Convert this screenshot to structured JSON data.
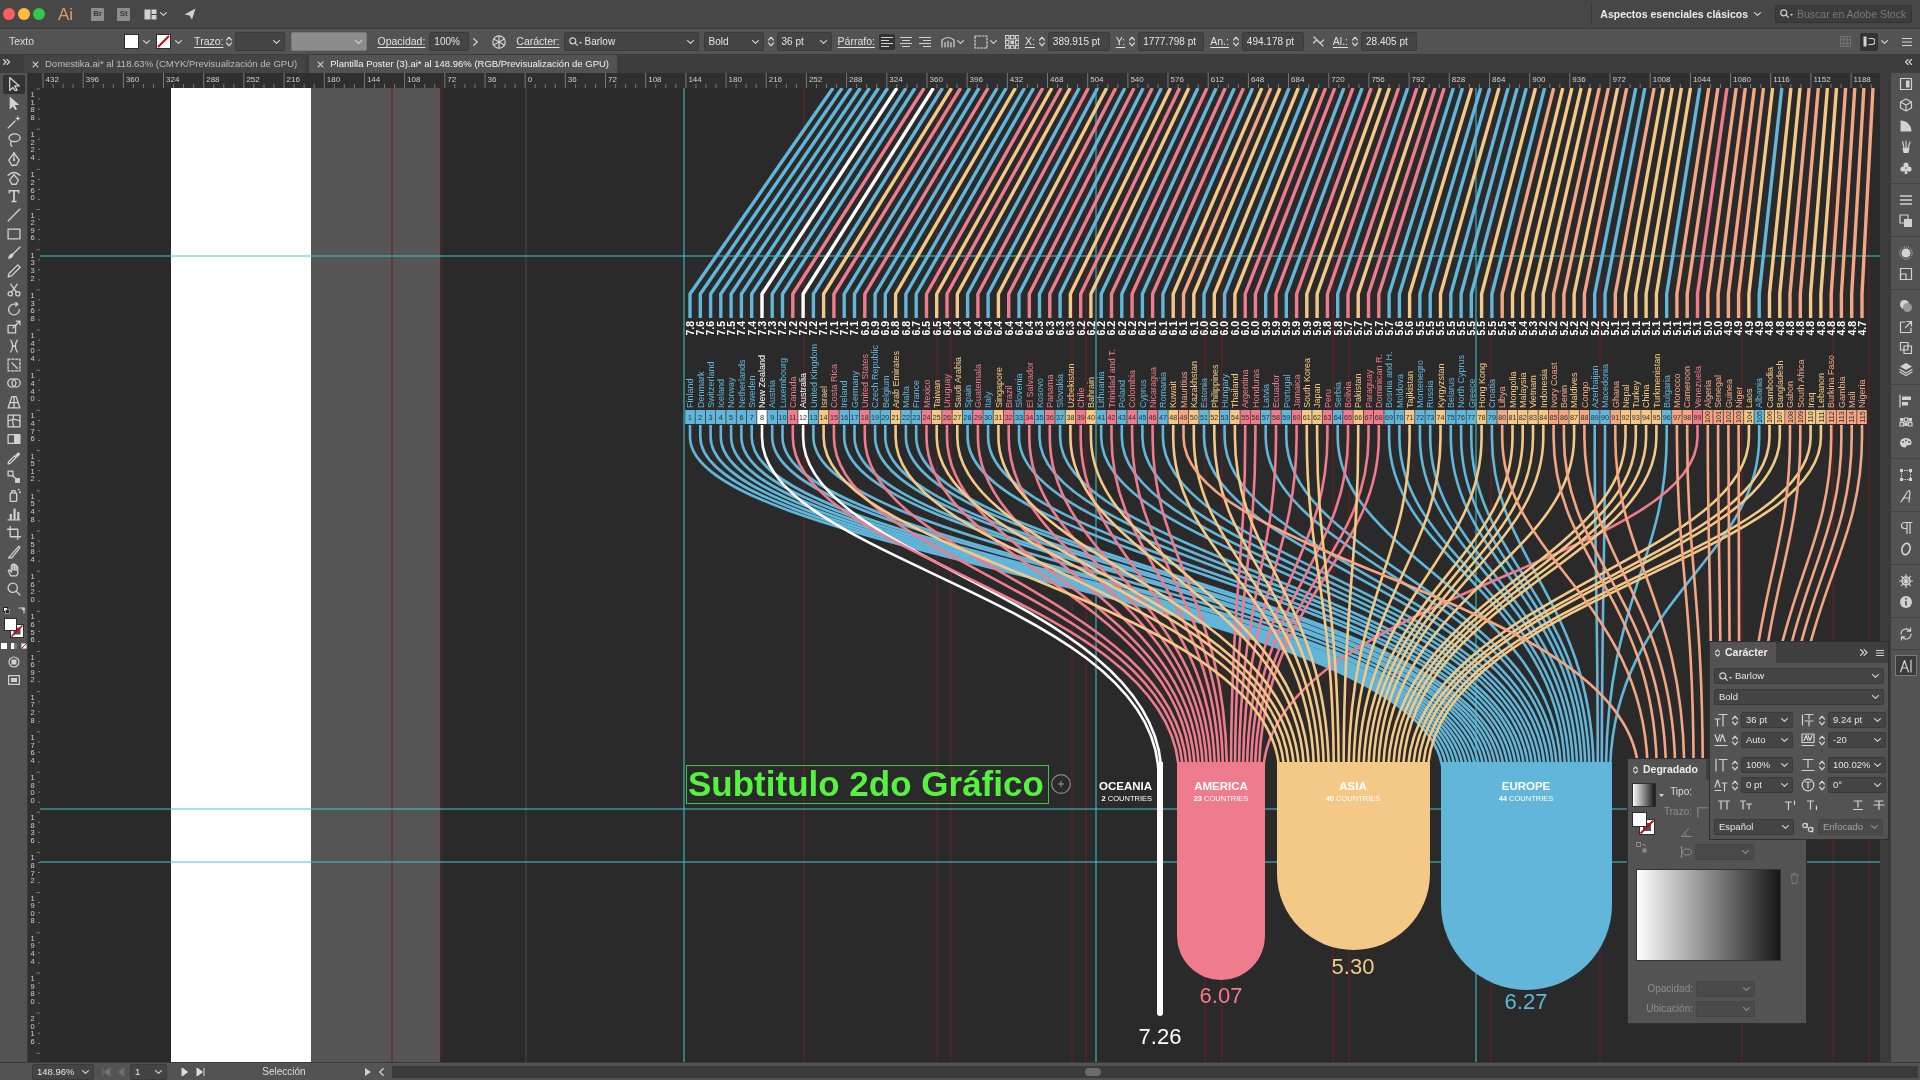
{
  "menubar": {
    "app_logo": "Ai",
    "apps": [
      "Br",
      "St"
    ],
    "workspace": "Aspectos esenciales clásicos",
    "search": {
      "placeholder": "Buscar en Adobe Stock"
    }
  },
  "control_bar": {
    "tool": "Texto",
    "stroke_label": "Trazo:",
    "opacity_label": "Opacidad:",
    "opacity": "100%",
    "character_label": "Carácter:",
    "font": "Barlow",
    "style": "Bold",
    "size": "36 pt",
    "paragraph_label": "Párrafo:",
    "align_buttons": [
      {
        "selected": true
      },
      {
        "selected": false
      },
      {
        "selected": false
      }
    ],
    "fields": [
      {
        "label": "X:",
        "value": "389.915 pt"
      },
      {
        "label": "Y:",
        "value": "1777.798 pt"
      },
      {
        "label": "An.:",
        "value": "494.178 pt"
      },
      {
        "label": "Al.:",
        "value": "28.405 pt"
      }
    ],
    "snap_toggle": {
      "on": true
    }
  },
  "tabs": [
    {
      "label": "Domestika.ai* al 118.63% (CMYK/Previsualización de GPU)",
      "selected": false
    },
    {
      "label": "Plantilla Poster (3).ai* al 148.96% (RGB/Previsualización de GPU)",
      "selected": true
    }
  ],
  "ruler": {
    "labels": [
      "432",
      "396",
      "360",
      "324",
      "288",
      "252",
      "216",
      "180",
      "144",
      "108",
      "72",
      "36",
      "0",
      "36",
      "72",
      "108",
      "144",
      "180",
      "216",
      "252",
      "288",
      "324",
      "360",
      "396",
      "432",
      "468",
      "504",
      "540",
      "576",
      "612",
      "648",
      "684",
      "720",
      "756",
      "792",
      "828",
      "864",
      "900",
      "936",
      "972",
      "1008",
      "1044",
      "1080",
      "1116",
      "1152",
      "1188"
    ]
  },
  "vertical_ruler": {
    "labels": [
      "1188",
      "1224",
      "1260",
      "1296",
      "1332",
      "1368",
      "1404",
      "1440",
      "1476",
      "1512",
      "1548",
      "1584",
      "1620",
      "1656",
      "1692",
      "1728",
      "1764",
      "1800",
      "1836",
      "1872",
      "1908",
      "1944",
      "1980",
      "2016"
    ]
  },
  "tools": [
    {
      "selected": true
    },
    {
      "selected": false
    },
    {
      "selected": false
    },
    {
      "selected": false
    },
    {
      "selected": false
    },
    {
      "selected": false
    },
    {
      "selected": false
    },
    {
      "selected": false
    },
    {
      "selected": false
    },
    {
      "selected": false
    },
    {
      "selected": false
    },
    {
      "selected": false
    },
    {
      "selected": false
    },
    {
      "selected": false
    },
    {
      "selected": false
    },
    {
      "selected": false
    },
    {
      "selected": false
    },
    {
      "selected": false
    },
    {
      "selected": false
    },
    {
      "selected": false
    },
    {
      "selected": false
    },
    {
      "selected": false
    },
    {
      "selected": false
    },
    {
      "selected": false
    },
    {
      "selected": false
    },
    {
      "selected": false
    },
    {
      "selected": false
    },
    {
      "selected": false
    }
  ],
  "dock": [
    {
      "selected": false
    },
    {
      "selected": false
    },
    {
      "selected": false
    },
    {
      "selected": false
    },
    {
      "selected": false
    },
    {
      "selected": false
    },
    {
      "selected": false
    },
    {
      "selected": false
    },
    {
      "selected": false
    },
    {
      "selected": false
    },
    {
      "selected": false
    },
    {
      "selected": false
    },
    {
      "selected": false
    },
    {
      "selected": false
    },
    {
      "selected": false
    },
    {
      "selected": false
    },
    {
      "selected": false
    },
    {
      "selected": false
    },
    {
      "selected": false
    },
    {
      "selected": false
    },
    {
      "selected": false
    },
    {
      "selected": false
    },
    {
      "selected": false
    },
    {
      "selected": true
    }
  ],
  "canvas": {
    "subtitle": "Subtitulo 2do Gráfico",
    "countries": [
      {
        "rank": "1",
        "name": "Finland",
        "score": "7.8",
        "color": "#62b6da"
      },
      {
        "rank": "2",
        "name": "Denmark",
        "score": "7.6",
        "color": "#62b6da"
      },
      {
        "rank": "3",
        "name": "Switzerland",
        "score": "7.6",
        "color": "#62b6da"
      },
      {
        "rank": "4",
        "name": "Iceland",
        "score": "7.5",
        "color": "#62b6da"
      },
      {
        "rank": "5",
        "name": "Norway",
        "score": "7.5",
        "color": "#62b6da"
      },
      {
        "rank": "6",
        "name": "Netherlands",
        "score": "7.4",
        "color": "#62b6da"
      },
      {
        "rank": "7",
        "name": "Sweden",
        "score": "7.4",
        "color": "#62b6da"
      },
      {
        "rank": "8",
        "name": "New Zealand",
        "score": "7.3",
        "color": "#ffffff"
      },
      {
        "rank": "9",
        "name": "Austria",
        "score": "7.3",
        "color": "#62b6da"
      },
      {
        "rank": "10",
        "name": "Luxembourg",
        "score": "7.2",
        "color": "#62b6da"
      },
      {
        "rank": "11",
        "name": "Canada",
        "score": "7.2",
        "color": "#ee7c8d"
      },
      {
        "rank": "12",
        "name": "Australia",
        "score": "7.2",
        "color": "#ffffff"
      },
      {
        "rank": "13",
        "name": "United Kingdom",
        "score": "7.2",
        "color": "#62b6da"
      },
      {
        "rank": "14",
        "name": "Israel",
        "score": "7.1",
        "color": "#f4c987"
      },
      {
        "rank": "15",
        "name": "Costa Rica",
        "score": "7.1",
        "color": "#ee7c8d"
      },
      {
        "rank": "16",
        "name": "Ireland",
        "score": "7.1",
        "color": "#62b6da"
      },
      {
        "rank": "17",
        "name": "Germany",
        "score": "7.1",
        "color": "#62b6da"
      },
      {
        "rank": "18",
        "name": "United States",
        "score": "6.9",
        "color": "#ee7c8d"
      },
      {
        "rank": "19",
        "name": "Czech Republic",
        "score": "6.9",
        "color": "#62b6da"
      },
      {
        "rank": "20",
        "name": "Belgium",
        "score": "6.9",
        "color": "#62b6da"
      },
      {
        "rank": "21",
        "name": "Arab Emirates",
        "score": "6.8",
        "color": "#f4c987"
      },
      {
        "rank": "22",
        "name": "Malta",
        "score": "6.8",
        "color": "#62b6da"
      },
      {
        "rank": "23",
        "name": "France",
        "score": "6.7",
        "color": "#62b6da"
      },
      {
        "rank": "24",
        "name": "Mexico",
        "score": "6.5",
        "color": "#ee7c8d"
      },
      {
        "rank": "25",
        "name": "Taiwan",
        "score": "6.5",
        "color": "#f4c987"
      },
      {
        "rank": "26",
        "name": "Uruguay",
        "score": "6.4",
        "color": "#ee7c8d"
      },
      {
        "rank": "27",
        "name": "Saudi Arabia",
        "score": "6.4",
        "color": "#f4c987"
      },
      {
        "rank": "28",
        "name": "Spain",
        "score": "6.4",
        "color": "#62b6da"
      },
      {
        "rank": "29",
        "name": "Guatemala",
        "score": "6.4",
        "color": "#ee7c8d"
      },
      {
        "rank": "30",
        "name": "Italy",
        "score": "6.4",
        "color": "#62b6da"
      },
      {
        "rank": "31",
        "name": "Singapore",
        "score": "6.4",
        "color": "#f4c987"
      },
      {
        "rank": "32",
        "name": "Brazil",
        "score": "6.4",
        "color": "#ee7c8d"
      },
      {
        "rank": "33",
        "name": "Slovenia",
        "score": "6.4",
        "color": "#62b6da"
      },
      {
        "rank": "34",
        "name": "El Salvador",
        "score": "6.4",
        "color": "#ee7c8d"
      },
      {
        "rank": "35",
        "name": "Kosovo",
        "score": "6.3",
        "color": "#62b6da"
      },
      {
        "rank": "36",
        "name": "Panama",
        "score": "6.3",
        "color": "#ee7c8d"
      },
      {
        "rank": "37",
        "name": "Slovakia",
        "score": "6.3",
        "color": "#62b6da"
      },
      {
        "rank": "38",
        "name": "Uzbekistan",
        "score": "6.3",
        "color": "#f4c987"
      },
      {
        "rank": "39",
        "name": "Chile",
        "score": "6.2",
        "color": "#ee7c8d"
      },
      {
        "rank": "40",
        "name": "Bahrain",
        "score": "6.2",
        "color": "#f4c987"
      },
      {
        "rank": "41",
        "name": "Lithuania",
        "score": "6.2",
        "color": "#62b6da"
      },
      {
        "rank": "42",
        "name": "Trinidad and T.",
        "score": "6.2",
        "color": "#ee7c8d"
      },
      {
        "rank": "43",
        "name": "Poland",
        "score": "6.2",
        "color": "#62b6da"
      },
      {
        "rank": "44",
        "name": "Colombia",
        "score": "6.2",
        "color": "#ee7c8d"
      },
      {
        "rank": "45",
        "name": "Cyprus",
        "score": "6.2",
        "color": "#62b6da"
      },
      {
        "rank": "46",
        "name": "Nicaragua",
        "score": "6.1",
        "color": "#ee7c8d"
      },
      {
        "rank": "47",
        "name": "Romania",
        "score": "6.1",
        "color": "#62b6da"
      },
      {
        "rank": "48",
        "name": "Kuwait",
        "score": "6.1",
        "color": "#f4c987"
      },
      {
        "rank": "49",
        "name": "Mauritius",
        "score": "6.1",
        "color": "#f3a684"
      },
      {
        "rank": "50",
        "name": "Kazakhstan",
        "score": "6.1",
        "color": "#f4c987"
      },
      {
        "rank": "51",
        "name": "Estonia",
        "score": "6.0",
        "color": "#62b6da"
      },
      {
        "rank": "52",
        "name": "Philippines",
        "score": "6.0",
        "color": "#f4c987"
      },
      {
        "rank": "53",
        "name": "Hungary",
        "score": "6.0",
        "color": "#62b6da"
      },
      {
        "rank": "54",
        "name": "Thailand",
        "score": "6.0",
        "color": "#f4c987"
      },
      {
        "rank": "55",
        "name": "Argentina",
        "score": "6.0",
        "color": "#ee7c8d"
      },
      {
        "rank": "56",
        "name": "Honduras",
        "score": "6.0",
        "color": "#ee7c8d"
      },
      {
        "rank": "57",
        "name": "Latvia",
        "score": "5.9",
        "color": "#62b6da"
      },
      {
        "rank": "58",
        "name": "Ecuador",
        "score": "5.9",
        "color": "#ee7c8d"
      },
      {
        "rank": "59",
        "name": "Portugal",
        "score": "5.9",
        "color": "#62b6da"
      },
      {
        "rank": "60",
        "name": "Jamaica",
        "score": "5.9",
        "color": "#ee7c8d"
      },
      {
        "rank": "61",
        "name": "South Korea",
        "score": "5.9",
        "color": "#f4c987"
      },
      {
        "rank": "62",
        "name": "Japan",
        "score": "5.9",
        "color": "#f4c987"
      },
      {
        "rank": "63",
        "name": "Peru",
        "score": "5.8",
        "color": "#ee7c8d"
      },
      {
        "rank": "64",
        "name": "Serbia",
        "score": "5.8",
        "color": "#62b6da"
      },
      {
        "rank": "65",
        "name": "Bolivia",
        "score": "5.7",
        "color": "#ee7c8d"
      },
      {
        "rank": "66",
        "name": "Pakistan",
        "score": "5.7",
        "color": "#f4c987"
      },
      {
        "rank": "67",
        "name": "Paraguay",
        "score": "5.7",
        "color": "#ee7c8d"
      },
      {
        "rank": "68",
        "name": "Dominican R.",
        "score": "5.7",
        "color": "#ee7c8d"
      },
      {
        "rank": "69",
        "name": "Bosnia and H.",
        "score": "5.7",
        "color": "#62b6da"
      },
      {
        "rank": "70",
        "name": "Moldova",
        "score": "5.6",
        "color": "#62b6da"
      },
      {
        "rank": "71",
        "name": "Tajikistan",
        "score": "5.6",
        "color": "#f4c987"
      },
      {
        "rank": "72",
        "name": "Montenegro",
        "score": "5.5",
        "color": "#62b6da"
      },
      {
        "rank": "73",
        "name": "Russia",
        "score": "5.5",
        "color": "#62b6da"
      },
      {
        "rank": "74",
        "name": "Kyrgyzstan",
        "score": "5.5",
        "color": "#f4c987"
      },
      {
        "rank": "75",
        "name": "Belarus",
        "score": "5.5",
        "color": "#62b6da"
      },
      {
        "rank": "76",
        "name": "North Cyprus",
        "score": "5.5",
        "color": "#62b6da"
      },
      {
        "rank": "77",
        "name": "Greece",
        "score": "5.5",
        "color": "#62b6da"
      },
      {
        "rank": "78",
        "name": "Hong Kong",
        "score": "5.5",
        "color": "#f4c987"
      },
      {
        "rank": "79",
        "name": "Croatia",
        "score": "5.5",
        "color": "#62b6da"
      },
      {
        "rank": "80",
        "name": "Libya",
        "score": "5.5",
        "color": "#f3a684"
      },
      {
        "rank": "81",
        "name": "Mongolia",
        "score": "5.4",
        "color": "#f4c987"
      },
      {
        "rank": "82",
        "name": "Malaysia",
        "score": "5.4",
        "color": "#f4c987"
      },
      {
        "rank": "83",
        "name": "Vietnam",
        "score": "5.3",
        "color": "#f4c987"
      },
      {
        "rank": "84",
        "name": "Indonesia",
        "score": "5.2",
        "color": "#f4c987"
      },
      {
        "rank": "85",
        "name": "Ivory Coast",
        "score": "5.2",
        "color": "#f3a684"
      },
      {
        "rank": "86",
        "name": "Benin",
        "score": "5.2",
        "color": "#f3a684"
      },
      {
        "rank": "87",
        "name": "Maldives",
        "score": "5.2",
        "color": "#f4c987"
      },
      {
        "rank": "88",
        "name": "Congo",
        "score": "5.2",
        "color": "#f3a684"
      },
      {
        "rank": "89",
        "name": "Azerbaijan",
        "score": "5.2",
        "color": "#62b6da"
      },
      {
        "rank": "90",
        "name": "Macedonia",
        "score": "5.2",
        "color": "#62b6da"
      },
      {
        "rank": "91",
        "name": "Ghana",
        "score": "5.1",
        "color": "#f3a684"
      },
      {
        "rank": "92",
        "name": "Nepal",
        "score": "5.1",
        "color": "#f4c987"
      },
      {
        "rank": "93",
        "name": "Turkey",
        "score": "5.1",
        "color": "#f4c987"
      },
      {
        "rank": "94",
        "name": "China",
        "score": "5.1",
        "color": "#f4c987"
      },
      {
        "rank": "95",
        "name": "Turkmenistan",
        "score": "5.1",
        "color": "#f4c987"
      },
      {
        "rank": "96",
        "name": "Bulgaria",
        "score": "5.1",
        "color": "#62b6da"
      },
      {
        "rank": "97",
        "name": "Morocco",
        "score": "5.1",
        "color": "#f3a684"
      },
      {
        "rank": "98",
        "name": "Cameroon",
        "score": "5.1",
        "color": "#f3a684"
      },
      {
        "rank": "99",
        "name": "Venezuela",
        "score": "5.1",
        "color": "#ee7c8d"
      },
      {
        "rank": "100",
        "name": "Algeria",
        "score": "5.0",
        "color": "#f3a684"
      },
      {
        "rank": "101",
        "name": "Senegal",
        "score": "5.0",
        "color": "#f3a684"
      },
      {
        "rank": "102",
        "name": "Guinea",
        "score": "4.9",
        "color": "#f3a684"
      },
      {
        "rank": "103",
        "name": "Niger",
        "score": "4.9",
        "color": "#f3a684"
      },
      {
        "rank": "104",
        "name": "Laos",
        "score": "4.9",
        "color": "#f4c987"
      },
      {
        "rank": "105",
        "name": "Albania",
        "score": "4.9",
        "color": "#62b6da"
      },
      {
        "rank": "106",
        "name": "Cambodia",
        "score": "4.8",
        "color": "#f4c987"
      },
      {
        "rank": "107",
        "name": "Bangladesh",
        "score": "4.8",
        "color": "#f4c987"
      },
      {
        "rank": "108",
        "name": "Gabon",
        "score": "4.8",
        "color": "#f3a684"
      },
      {
        "rank": "109",
        "name": "South Africa",
        "score": "4.8",
        "color": "#f3a684"
      },
      {
        "rank": "110",
        "name": "Iraq",
        "score": "4.8",
        "color": "#f4c987"
      },
      {
        "rank": "111",
        "name": "Lebanon",
        "score": "4.8",
        "color": "#f4c987"
      },
      {
        "rank": "112",
        "name": "Burkina Faso",
        "score": "4.8",
        "color": "#f3a684"
      },
      {
        "rank": "113",
        "name": "Gambia",
        "score": "4.8",
        "color": "#f3a684"
      },
      {
        "rank": "114",
        "name": "Mali",
        "score": "4.8",
        "color": "#f3a684"
      },
      {
        "rank": "115",
        "name": "Nigeria",
        "score": "4.7",
        "color": "#f3a684"
      }
    ],
    "continents": [
      {
        "name": "OCEANIA",
        "count": "**2** COUNTRIES",
        "average": "7.26",
        "color": "#ffffff"
      },
      {
        "name": "AMERICA",
        "count": "**23** COUNTRIES",
        "average": "6.07",
        "color": "#ee7c8d"
      },
      {
        "name": "ASIA",
        "count": "**40** COUNTRIES",
        "average": "5.30",
        "color": "#f4c987"
      },
      {
        "name": "EUROPE",
        "count": "**44** COUNTRIES",
        "average": "6.27",
        "color": "#62b6da"
      }
    ]
  },
  "character_panel": {
    "title": "Carácter",
    "font": "Barlow",
    "style": "Bold",
    "size": "36 pt",
    "leading": "9.24 pt",
    "kerning": "Auto",
    "tracking": "-20",
    "vertical_scale": "100%",
    "horizontal_scale": "100.02%",
    "baseline_shift": "0 pt",
    "rotation": "0°",
    "language": "Español",
    "antialiasing": {
      "value": "Enfocado",
      "disabled": true
    }
  },
  "gradient_panel": {
    "title": "Degradado",
    "type": {
      "label": "Tipo:",
      "disabled": false
    },
    "stroke": {
      "label": "Trazo:",
      "disabled": true
    },
    "stop_fields": [
      {
        "label": "Opacidad:",
        "disabled": true
      },
      {
        "label": "Ubicación:",
        "disabled": true
      }
    ]
  },
  "status_bar": {
    "zoom": "148.96%",
    "artboard": "1",
    "tool": "Selección",
    "nav": [
      {
        "disabled": true
      },
      {
        "disabled": true
      },
      {
        "disabled": false
      },
      {
        "disabled": false
      }
    ]
  }
}
